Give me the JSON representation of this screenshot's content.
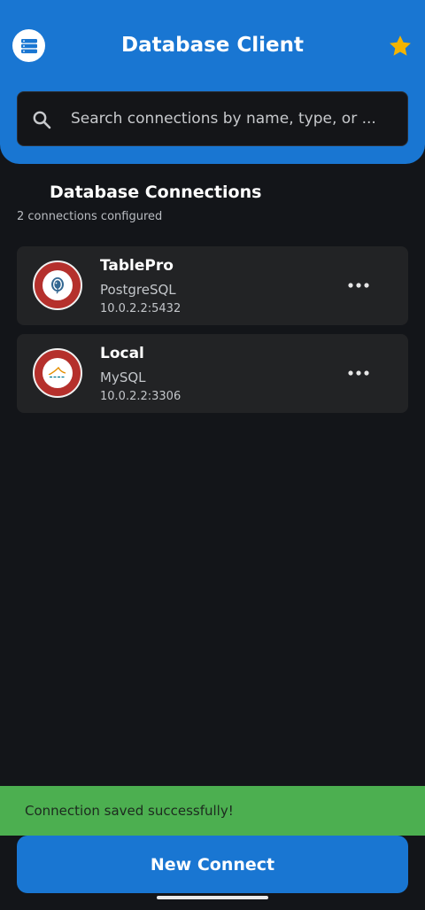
{
  "header": {
    "title": "Database Client",
    "menu_icon": "database-menu-icon",
    "favorite_icon": "star-icon",
    "accent_color": "#1976d2",
    "star_color": "#f4b400"
  },
  "search": {
    "placeholder": "Search connections by name, type, or ...",
    "value": ""
  },
  "connections_section": {
    "title": "Database Connections",
    "subtitle": "2 connections configured"
  },
  "connections": [
    {
      "name": "TablePro",
      "type": "PostgreSQL",
      "host": "10.0.2.2:5432",
      "logo": "postgresql-logo-icon",
      "more_icon": "more-horizontal-icon"
    },
    {
      "name": "Local",
      "type": "MySQL",
      "host": "10.0.2.2:3306",
      "logo": "mysql-logo-icon",
      "more_icon": "more-horizontal-icon"
    }
  ],
  "snackbar": {
    "message": "Connection saved successfully!",
    "color": "#4caf50"
  },
  "primary_action": {
    "label": "New Connect"
  }
}
